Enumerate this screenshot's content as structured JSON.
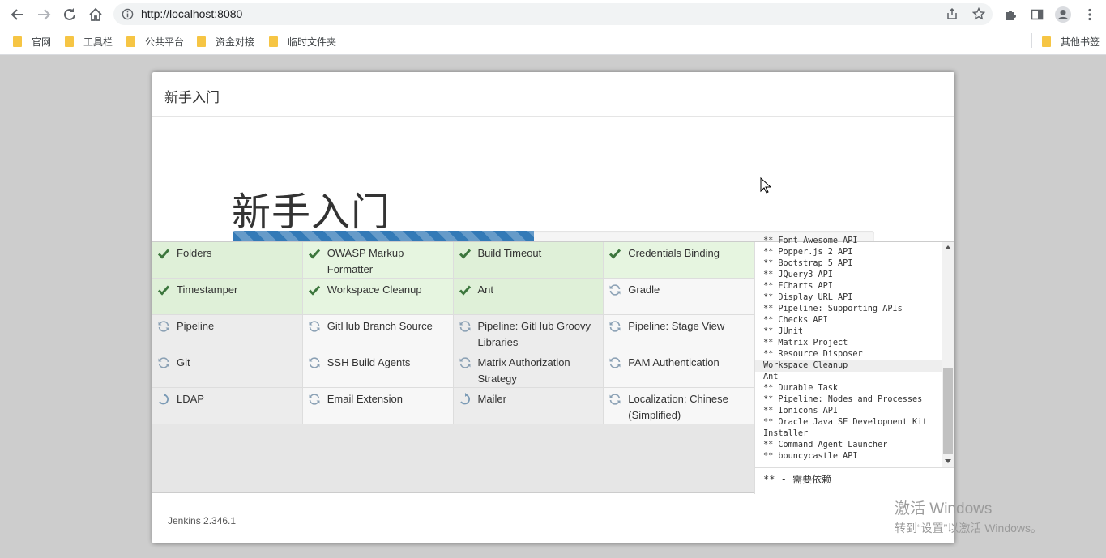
{
  "browser": {
    "url": "http://localhost:8080",
    "bookmarks": [
      "官网",
      "工具栏",
      "公共平台",
      "资金对接",
      "临时文件夹"
    ],
    "other_bookmarks": "其他书签"
  },
  "dialog": {
    "header_title": "新手入门",
    "hero_title": "新手入门",
    "progress_percent": 47,
    "plugins": [
      [
        {
          "name": "Folders",
          "status": "ok"
        },
        {
          "name": "OWASP Markup Formatter",
          "status": "ok"
        },
        {
          "name": "Build Timeout",
          "status": "ok"
        },
        {
          "name": "Credentials Binding",
          "status": "ok"
        }
      ],
      [
        {
          "name": "Timestamper",
          "status": "ok"
        },
        {
          "name": "Workspace Cleanup",
          "status": "ok"
        },
        {
          "name": "Ant",
          "status": "ok"
        },
        {
          "name": "Gradle",
          "status": "pending"
        }
      ],
      [
        {
          "name": "Pipeline",
          "status": "pending"
        },
        {
          "name": "GitHub Branch Source",
          "status": "pending"
        },
        {
          "name": "Pipeline: GitHub Groovy Libraries",
          "status": "pending"
        },
        {
          "name": "Pipeline: Stage View",
          "status": "pending"
        }
      ],
      [
        {
          "name": "Git",
          "status": "pending"
        },
        {
          "name": "SSH Build Agents",
          "status": "pending"
        },
        {
          "name": "Matrix Authorization Strategy",
          "status": "pending"
        },
        {
          "name": "PAM Authentication",
          "status": "pending"
        }
      ],
      [
        {
          "name": "LDAP",
          "status": "installing"
        },
        {
          "name": "Email Extension",
          "status": "pending"
        },
        {
          "name": "Mailer",
          "status": "installing"
        },
        {
          "name": "Localization: Chinese (Simplified)",
          "status": "pending"
        }
      ]
    ],
    "log_lines": [
      "** Font Awesome API",
      "** Popper.js 2 API",
      "** Bootstrap 5 API",
      "** JQuery3 API",
      "** ECharts API",
      "** Display URL API",
      "** Pipeline: Supporting APIs",
      "** Checks API",
      "** JUnit",
      "** Matrix Project",
      "** Resource Disposer",
      "Workspace Cleanup",
      "Ant",
      "** Durable Task",
      "** Pipeline: Nodes and Processes",
      "** Ionicons API",
      "** Oracle Java SE Development Kit Installer",
      "** Command Agent Launcher",
      "** bouncycastle API"
    ],
    "log_footer": "** - 需要依赖",
    "version": "Jenkins 2.346.1"
  },
  "watermark": {
    "line1": "激活 Windows",
    "line2": "转到“设置”以激活 Windows。"
  },
  "colors": {
    "progress": "#337ab7",
    "success_bg": "#dff0d8",
    "check": "#3c763d"
  }
}
